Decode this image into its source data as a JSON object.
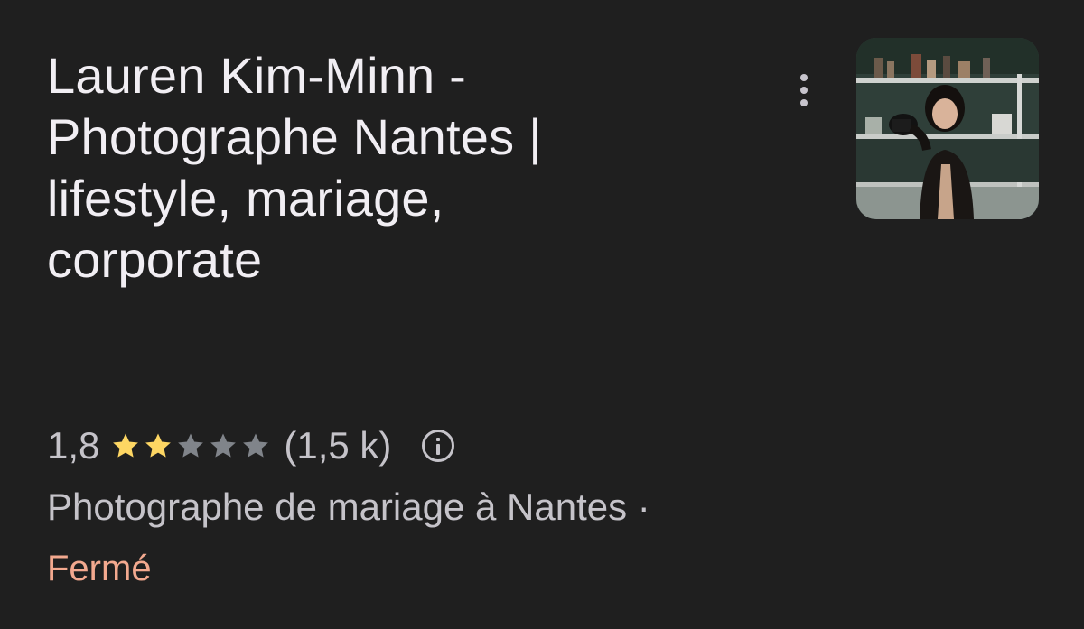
{
  "listing": {
    "title_lines": [
      "Lauren Kim-Minn -",
      "Photographe Nantes |",
      "lifestyle, mariage,",
      "corporate"
    ],
    "rating": {
      "value_text": "1,8",
      "value": 1.8,
      "max": 5,
      "filled_stars": 2,
      "count_text": "(1,5 k)",
      "star_color_filled": "#fdd663",
      "star_color_empty": "#80848a"
    },
    "category": "Photographe de mariage à Nantes ·",
    "status": {
      "label": "Fermé",
      "color": "#f3a98f"
    },
    "icons": {
      "menu": "more-vert-icon",
      "info": "info-icon",
      "thumbnail": "business-photo"
    }
  }
}
